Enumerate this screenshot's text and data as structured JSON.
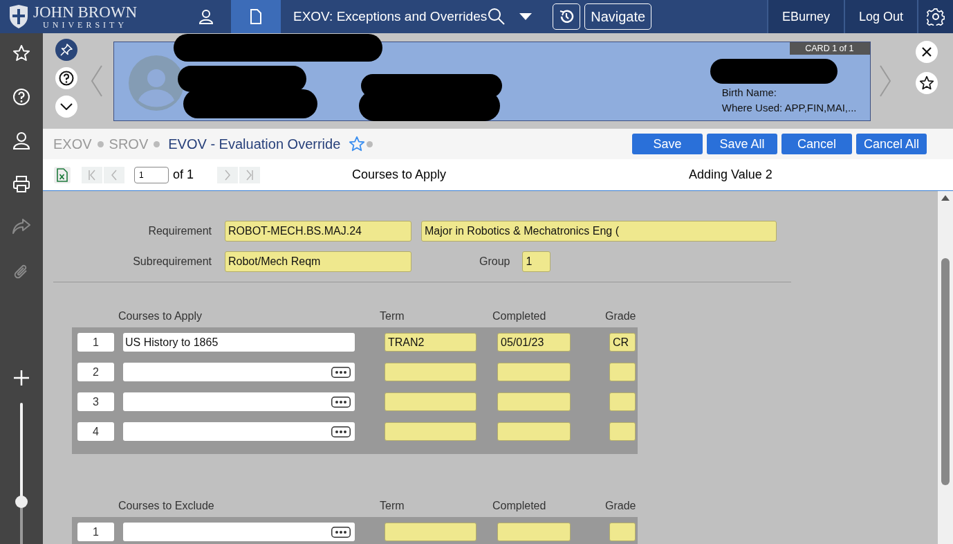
{
  "header": {
    "logo": {
      "name": "JOHN BROWN",
      "subtitle": "UNIVERSITY"
    },
    "nav_tabs": [
      {
        "kind": "person",
        "selected": false
      },
      {
        "kind": "document",
        "selected": true
      }
    ],
    "title": "EXOV: Exceptions and Overrides",
    "navigate_button": "Navigate",
    "user": "EBurney",
    "logout": "Log Out"
  },
  "sidebar": {
    "items": [
      {
        "kind": "star",
        "disabled": false
      },
      {
        "kind": "help",
        "disabled": false
      },
      {
        "kind": "person",
        "disabled": false
      },
      {
        "kind": "printer",
        "disabled": false
      },
      {
        "kind": "share",
        "disabled": true
      },
      {
        "kind": "paperclip",
        "disabled": true
      }
    ],
    "zoom": {
      "level": 0.3
    }
  },
  "person_card": {
    "badge": "CARD 1 of 1",
    "lines": [
      "Birth Name:",
      "Where Used: APP,FIN,MAI,..."
    ]
  },
  "breadcrumb": {
    "items": [
      {
        "label": "EXOV",
        "current": false
      },
      {
        "label": "SROV",
        "current": false
      },
      {
        "label": "EVOV - Evaluation Override",
        "current": true
      }
    ]
  },
  "actions": [
    "Save",
    "Save All",
    "Cancel",
    "Cancel All"
  ],
  "pager": {
    "page": "1",
    "of": "of 1",
    "buttons": [
      {
        "kind": "first",
        "disabled": true
      },
      {
        "kind": "prev",
        "disabled": true
      },
      {
        "kind": "next",
        "disabled": true
      },
      {
        "kind": "last",
        "disabled": true
      }
    ]
  },
  "form_title": "Courses to Apply",
  "mode": "Adding Value 2",
  "fields": {
    "requirement": {
      "label": "Requirement",
      "value": "ROBOT-MECH.BS.MAJ.24",
      "description": "Major in Robotics & Mechatronics Eng ("
    },
    "subrequirement": {
      "label": "Subrequirement",
      "value": "Robot/Mech Reqm"
    },
    "group": {
      "label": "Group",
      "value": "1"
    }
  },
  "sections": [
    {
      "columns": [
        "Courses to Apply",
        "Term",
        "Completed",
        "Grade"
      ],
      "rows": [
        {
          "number": "1",
          "course": "US History to 1865",
          "term": "TRAN2",
          "completed": "05/01/23",
          "grade": "CR",
          "lookup": false
        },
        {
          "number": "2",
          "lookup": true
        },
        {
          "number": "3",
          "lookup": true
        },
        {
          "number": "4",
          "lookup": true
        }
      ]
    },
    {
      "columns": [
        "Courses to Exclude",
        "Term",
        "Completed",
        "Grade"
      ],
      "rows": [
        {
          "number": "1",
          "lookup": true
        }
      ]
    }
  ]
}
